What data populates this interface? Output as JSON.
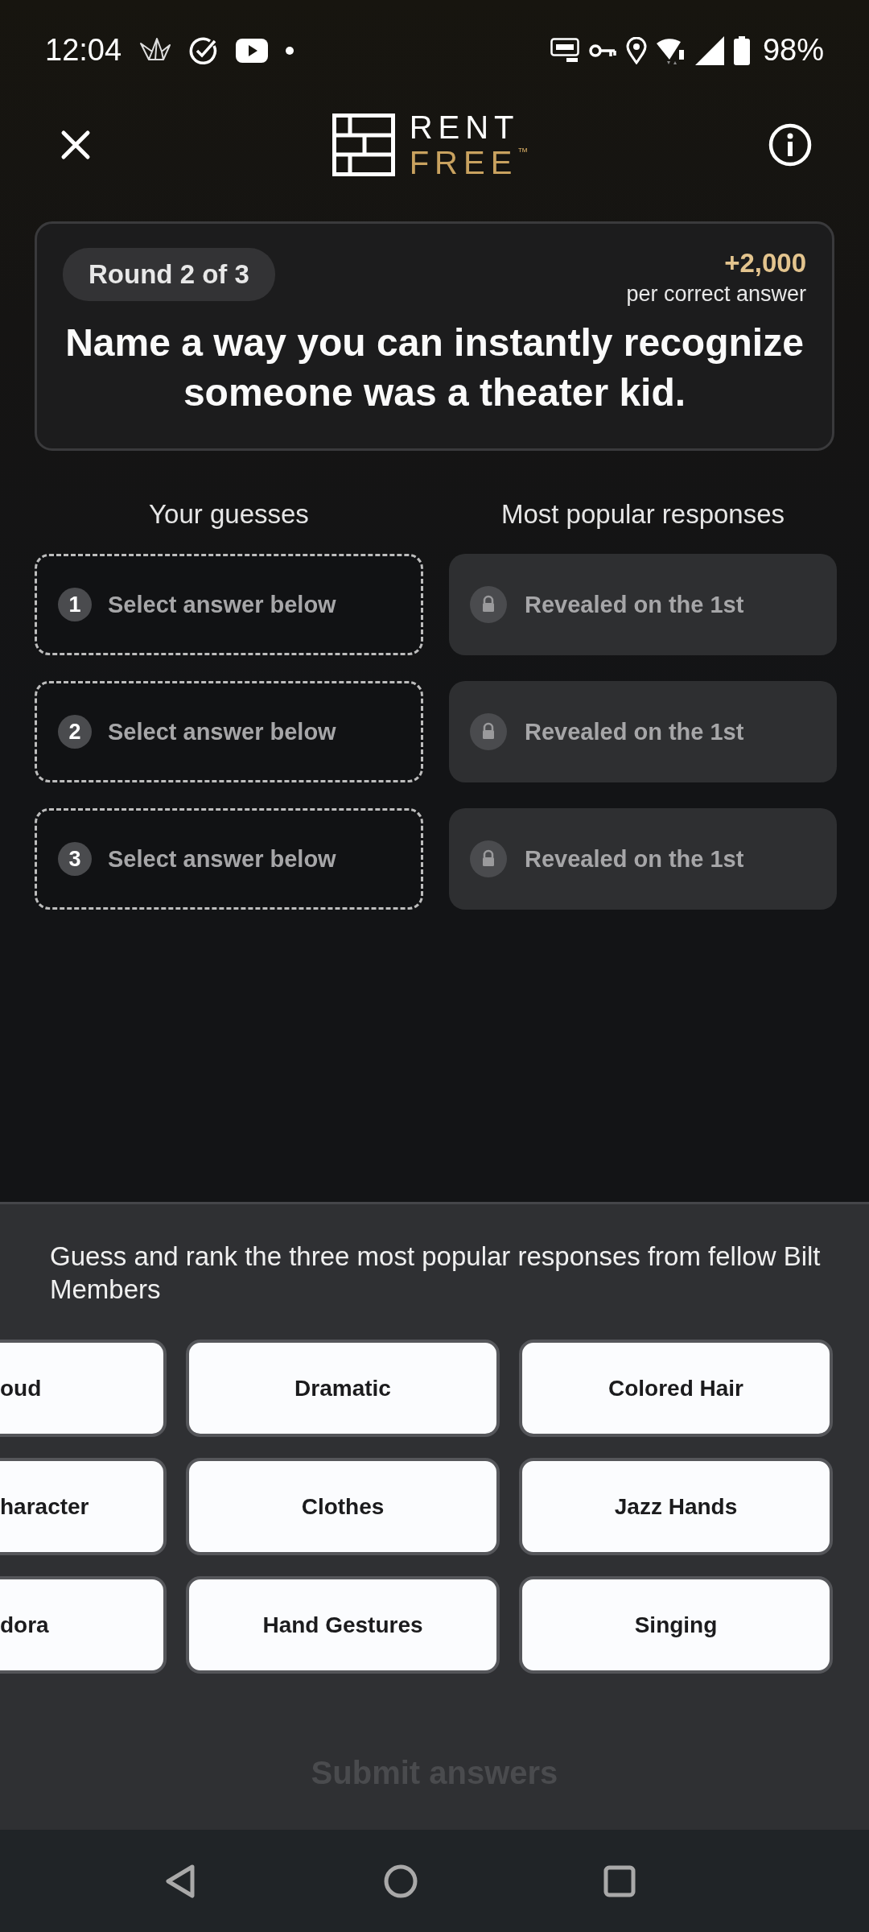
{
  "status_bar": {
    "time": "12:04",
    "battery": "98%"
  },
  "header": {
    "logo": {
      "line_1": "RENT",
      "line_2": "FREE",
      "mark": "™"
    }
  },
  "round_card": {
    "round": "Round 2 of 3",
    "points": "+2,000",
    "points_note": "per correct answer",
    "question": "Name a way you can instantly recognize someone was a theater kid."
  },
  "columns": [
    "Your guesses",
    "Most popular responses"
  ],
  "guesses": [
    {
      "number": "1",
      "text": "Select answer below"
    },
    {
      "number": "2",
      "text": "Select answer below"
    },
    {
      "number": "3",
      "text": "Select answer below"
    }
  ],
  "responses": [
    {
      "text": "Revealed on the 1st",
      "locked": true
    },
    {
      "text": "Revealed on the 1st",
      "locked": true
    },
    {
      "text": "Revealed on the 1st",
      "locked": true
    }
  ],
  "instruction": "Guess and rank the three most popular responses from fellow Bilt Members",
  "options": [
    {
      "label": "oud",
      "kind": "cut"
    },
    {
      "label": "Dramatic",
      "kind": "full"
    },
    {
      "label": "Colored Hair",
      "kind": "full"
    },
    {
      "label": "haracter",
      "kind": "cut"
    },
    {
      "label": "Clothes",
      "kind": "full"
    },
    {
      "label": "Jazz Hands",
      "kind": "full"
    },
    {
      "label": "dora",
      "kind": "cut"
    },
    {
      "label": "Hand Gestures",
      "kind": "full"
    },
    {
      "label": "Singing",
      "kind": "full"
    }
  ],
  "submit": {
    "label": "Submit answers",
    "disabled": true
  }
}
